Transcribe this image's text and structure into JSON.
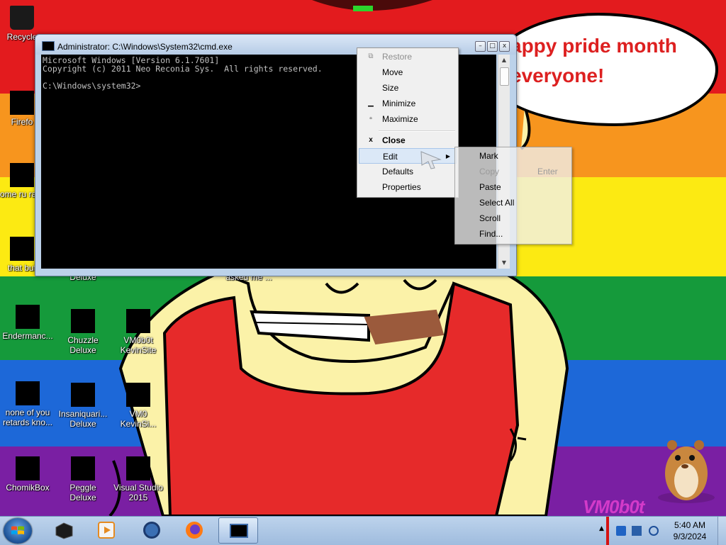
{
  "desktop": {
    "speech_text": "appy pride month\neveryone!",
    "watermark": "VM0b0t",
    "icons": [
      {
        "label": "Recycle"
      },
      {
        "label": "Firefo"
      },
      {
        "label": "some ru ran e"
      },
      {
        "label": "that but"
      },
      {
        "label": "Deluxe"
      },
      {
        "label": "asked me ..."
      },
      {
        "label": "Endermanc..."
      },
      {
        "label": "Chuzzle Deluxe"
      },
      {
        "label": "VM0b0t KevinSite"
      },
      {
        "label": "none of you retards kno..."
      },
      {
        "label": "Insaniquari... Deluxe"
      },
      {
        "label": "VM0 KevinSi..."
      },
      {
        "label": "ChomikBox"
      },
      {
        "label": "Peggle Deluxe"
      },
      {
        "label": "Visual Studio 2015"
      }
    ]
  },
  "cmd": {
    "title": "Administrator: C:\\Windows\\System32\\cmd.exe",
    "console_text": "Microsoft Windows [Version 6.1.7601]\nCopyright (c) 2011 Neo Reconia Sys.  All rights reserved.\n\nC:\\Windows\\system32>",
    "controls": {
      "minimize": "–",
      "maximize": "□",
      "close": "x"
    }
  },
  "system_menu": {
    "items": [
      {
        "label": "Restore",
        "icon": "restore-glyph",
        "glyph": "⧉",
        "disabled": true
      },
      {
        "label": "Move",
        "disabled": false
      },
      {
        "label": "Size",
        "disabled": false
      },
      {
        "label": "Minimize",
        "icon": "minimize-glyph",
        "glyph": "▁",
        "disabled": false
      },
      {
        "label": "Maximize",
        "icon": "maximize-glyph",
        "glyph": "▫",
        "disabled": false
      },
      {
        "label": "Close",
        "icon": "close-glyph",
        "glyph": "x",
        "bold": true,
        "disabled": false
      },
      {
        "label": "Edit",
        "has_submenu": true,
        "highlighted": true
      },
      {
        "label": "Defaults",
        "disabled": false
      },
      {
        "label": "Properties",
        "disabled": false
      }
    ]
  },
  "edit_menu": {
    "items": [
      {
        "label": "Mark"
      },
      {
        "label": "Copy",
        "accelerator": "Enter",
        "disabled": true
      },
      {
        "label": "Paste"
      },
      {
        "label": "Select All"
      },
      {
        "label": "Scroll"
      },
      {
        "label": "Find..."
      }
    ]
  },
  "taskbar": {
    "clock_time": "5:40 AM",
    "clock_date": "9/3/2024",
    "apps": [
      {
        "name": "black-box-app-icon"
      },
      {
        "name": "media-player-icon"
      },
      {
        "name": "globe-browser-icon"
      },
      {
        "name": "firefox-icon"
      },
      {
        "name": "cmd-taskbar-icon",
        "active": true
      }
    ]
  },
  "colors": {
    "pride_red": "#e31b1e",
    "pride_orange": "#f7951e",
    "pride_yellow": "#fcea12",
    "pride_green": "#159a3b",
    "pride_blue": "#1d68d8",
    "pride_purple": "#7a1fa3",
    "speech_text": "#dd2020",
    "watermark": "#d33ac9"
  }
}
